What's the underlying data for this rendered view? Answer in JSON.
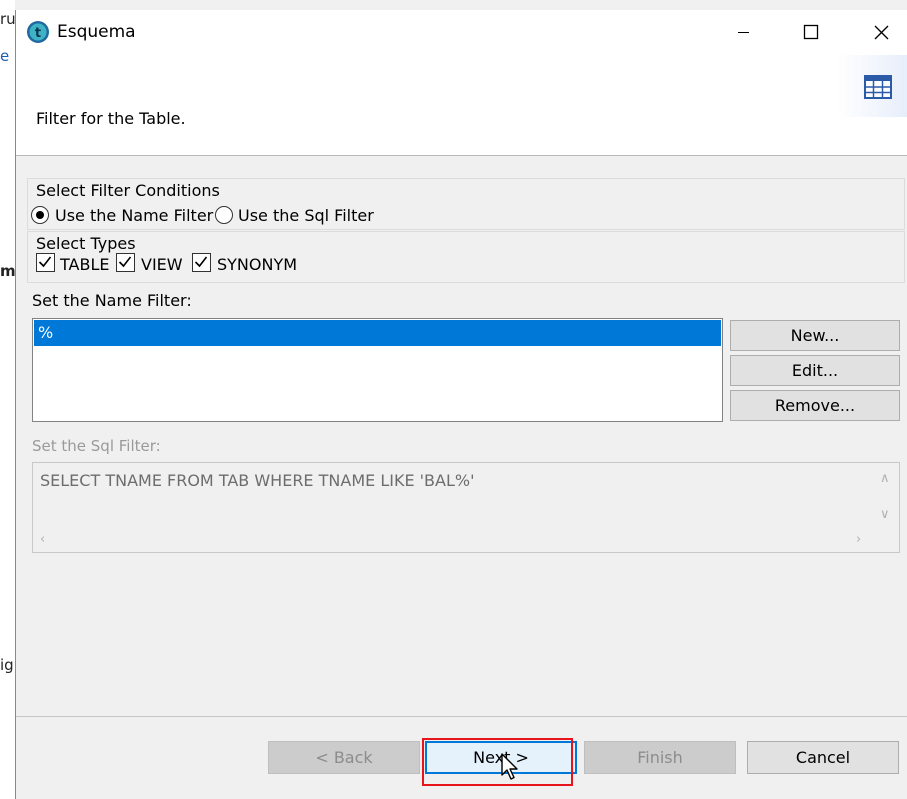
{
  "background": {
    "fragments": [
      "ruc",
      "e",
      "ma",
      "ig"
    ]
  },
  "window": {
    "title": "Esquema",
    "controls": {
      "minimize": "minimize",
      "maximize": "maximize",
      "close": "close"
    }
  },
  "banner": {
    "text": "Filter for the Table.",
    "icon": "table-icon"
  },
  "filter_conditions": {
    "title": "Select Filter Conditions",
    "options": [
      {
        "label": "Use the Name Filter",
        "selected": true
      },
      {
        "label": "Use the Sql Filter",
        "selected": false
      }
    ]
  },
  "types": {
    "title": "Select Types",
    "items": [
      {
        "label": "TABLE",
        "checked": true
      },
      {
        "label": "VIEW",
        "checked": true
      },
      {
        "label": "SYNONYM",
        "checked": true
      }
    ]
  },
  "name_filter": {
    "label": "Set the Name Filter:",
    "items": [
      "%"
    ],
    "buttons": {
      "new": "New...",
      "edit": "Edit...",
      "remove": "Remove..."
    }
  },
  "sql_filter": {
    "label": "Set the Sql Filter:",
    "value": "SELECT TNAME FROM TAB WHERE TNAME LIKE 'BAL%'"
  },
  "footer": {
    "back": "< Back",
    "next": "Next >",
    "finish": "Finish",
    "cancel": "Cancel"
  },
  "colors": {
    "selection": "#0078d7",
    "highlight": "#e8141c"
  }
}
